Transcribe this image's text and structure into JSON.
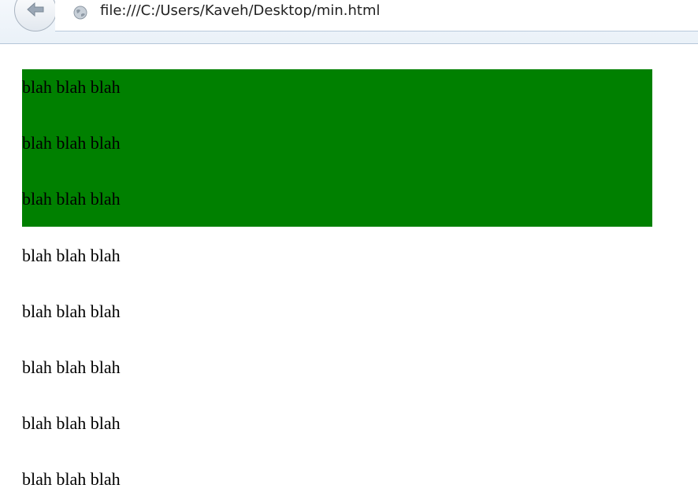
{
  "browser": {
    "url": "file:///C:/Users/Kaveh/Desktop/min.html",
    "back_icon": "back-arrow-icon",
    "site_icon": "globe-icon"
  },
  "page": {
    "box_color": "#008000",
    "box_paragraphs": [
      "blah blah blah",
      "blah blah blah",
      "blah blah blah"
    ],
    "paragraphs": [
      "blah blah blah",
      "blah blah blah",
      "blah blah blah",
      "blah blah blah",
      "blah blah blah"
    ]
  }
}
